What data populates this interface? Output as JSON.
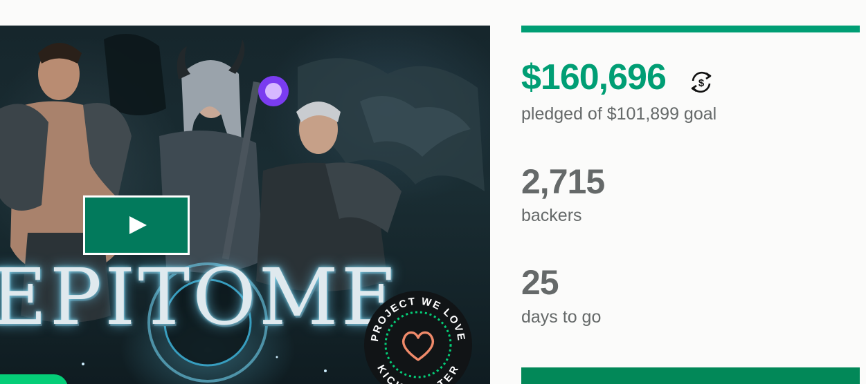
{
  "video": {
    "game_title": "EPITOME",
    "badge_text_top": "PROJECT WE LOVE",
    "badge_text_bottom": "KICKSTARTER",
    "play_icon": "play-icon",
    "badge_icon": "heart-icon"
  },
  "stats": {
    "funded_fraction": 1.0,
    "pledged_amount": "$160,696",
    "pledged_label": "pledged of $101,899 goal",
    "currency_icon": "currency-conversion-icon",
    "backers_count": "2,715",
    "backers_label": "backers",
    "days_count": "25",
    "days_label": "days to go"
  },
  "colors": {
    "accent": "#009e74",
    "play_button": "#027a5c",
    "back_button": "#028858",
    "text_muted": "#656969",
    "chip": "#05ce78"
  }
}
